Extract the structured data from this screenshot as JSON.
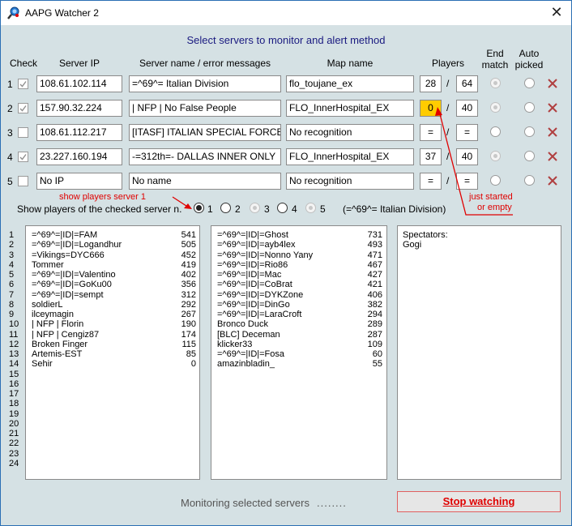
{
  "window": {
    "title": "AAPG Watcher 2"
  },
  "heading": "Select servers to monitor and alert method",
  "columns": {
    "check": "Check",
    "ip": "Server IP",
    "name": "Server name / error messages",
    "map": "Map name",
    "players": "Players",
    "end_match_1": "End",
    "end_match_2": "match",
    "auto_1": "Auto",
    "auto_2": "picked"
  },
  "servers": [
    {
      "n": "1",
      "ip": "108.61.102.114",
      "name": "=^69^= Italian Division",
      "map": "flo_toujane_ex",
      "players": "28",
      "max": "64"
    },
    {
      "n": "2",
      "ip": "157.90.32.224",
      "name": "| NFP | No False People",
      "map": "FLO_InnerHospital_EX",
      "players": "0",
      "max": "40"
    },
    {
      "n": "3",
      "ip": "108.61.112.217",
      "name": "[ITASF] ITALIAN SPECIAL FORCES",
      "map": "No recognition",
      "players": "=",
      "max": "="
    },
    {
      "n": "4",
      "ip": "23.227.160.194",
      "name": "-=312th=- DALLAS INNER ONLY",
      "map": "FLO_InnerHospital_EX",
      "players": "37",
      "max": "40"
    },
    {
      "n": "5",
      "ip": "No IP",
      "name": "No name",
      "map": "No recognition",
      "players": "=",
      "max": "="
    }
  ],
  "show_players": {
    "label": "Show players of the checked server n.",
    "options": [
      "1",
      "2",
      "3",
      "4",
      "5"
    ],
    "selected_name": "(=^69^= Italian Division)"
  },
  "annotations": {
    "show_players_note": "show players server 1",
    "just_started_1": "just started",
    "just_started_2": "or empty"
  },
  "line_numbers": [
    "1",
    "2",
    "3",
    "4",
    "5",
    "6",
    "7",
    "8",
    "9",
    "10",
    "11",
    "12",
    "13",
    "14",
    "15",
    "16",
    "17",
    "18",
    "19",
    "20",
    "21",
    "22",
    "23",
    "24"
  ],
  "team1": [
    {
      "name": "=^69^=|ID|=FAM",
      "score": "541"
    },
    {
      "name": "=^69^=|ID|=Logandhur",
      "score": "505"
    },
    {
      "name": "=Vikings=DYC666",
      "score": "452"
    },
    {
      "name": "Tommer",
      "score": "419"
    },
    {
      "name": "=^69^=|ID|=Valentino",
      "score": "402"
    },
    {
      "name": "=^69^=|ID|=GoKu00",
      "score": "356"
    },
    {
      "name": "=^69^=|ID|=sempt",
      "score": "312"
    },
    {
      "name": "soldierL",
      "score": "292"
    },
    {
      "name": "ilceymagin",
      "score": "267"
    },
    {
      "name": "| NFP | Florin",
      "score": "190"
    },
    {
      "name": "| NFP | Cengiz87",
      "score": "174"
    },
    {
      "name": "Broken Finger",
      "score": "115"
    },
    {
      "name": "Artemis-EST",
      "score": "85"
    },
    {
      "name": "Sehir",
      "score": "0"
    }
  ],
  "team2": [
    {
      "name": "=^69^=|ID|=Ghost",
      "score": "731"
    },
    {
      "name": "=^69^=|ID|=ayb4lex",
      "score": "493"
    },
    {
      "name": "=^69^=|ID|=Nonno Yany",
      "score": "471"
    },
    {
      "name": "=^69^=|ID|=Rio86",
      "score": "467"
    },
    {
      "name": "=^69^=|ID|=Mac",
      "score": "427"
    },
    {
      "name": "=^69^=|ID|=CoBrat",
      "score": "421"
    },
    {
      "name": "=^69^=|ID|=DYKZone",
      "score": "406"
    },
    {
      "name": "=^69^=|ID|=DinGo",
      "score": "382"
    },
    {
      "name": "=^69^=|ID|=LaraCroft",
      "score": "294"
    },
    {
      "name": "Bronco Duck",
      "score": "289"
    },
    {
      "name": "[BLC] Deceman",
      "score": "287"
    },
    {
      "name": "klicker33",
      "score": "109"
    },
    {
      "name": "=^69^=|ID|=Fosa",
      "score": "60"
    },
    {
      "name": "amazinbladin_",
      "score": "55"
    }
  ],
  "spectators": {
    "label": "Spectators:",
    "names": [
      "Gogi"
    ]
  },
  "status": {
    "text": "Monitoring selected servers",
    "dots": "........",
    "stop_label": "Stop watching"
  },
  "colors": {
    "accent_text": "#1a1a80",
    "alert": "#e00000",
    "empty_players": "#ffcc00"
  }
}
